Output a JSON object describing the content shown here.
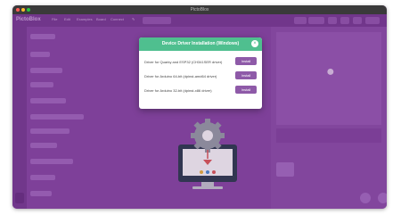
{
  "window": {
    "title": "PictoBlox"
  },
  "menubar": {
    "logo": "PictoBlox",
    "items": [
      "File",
      "Edit",
      "Examples",
      "Board",
      "Connect",
      "",
      "Mode"
    ]
  },
  "dialog": {
    "title": "Device Driver Installation (Windows)",
    "close_label": "×",
    "rows": [
      {
        "label": "Driver for Quarky and ESP32 (CH341SER driver)",
        "button": "Install"
      },
      {
        "label": "Driver for Arduino 64-bit (dpinst-amd64 driver)",
        "button": "Install"
      },
      {
        "label": "Driver for Arduino 32-bit (dpinst-x86 driver)",
        "button": "Install"
      }
    ]
  },
  "colors": {
    "accent": "#4fbf8f",
    "app_bg": "#8a4aa8",
    "install_button": "#8e5aa8"
  }
}
